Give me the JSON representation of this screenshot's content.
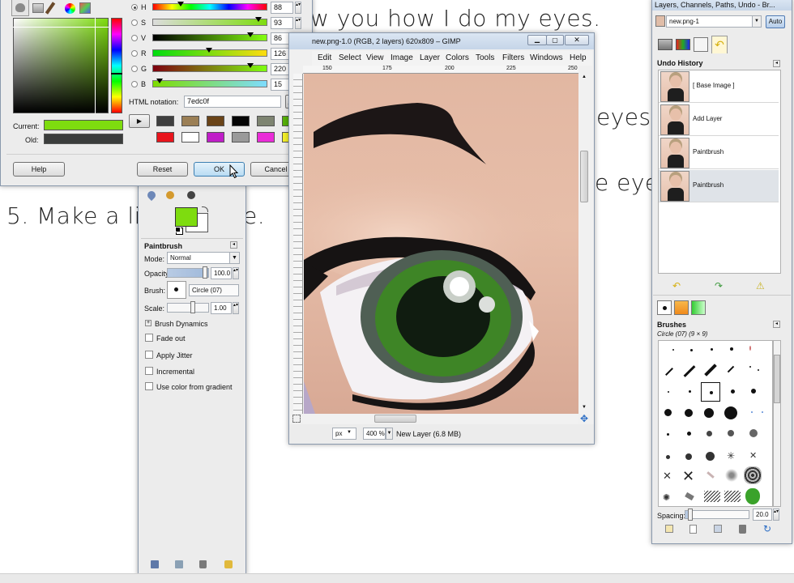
{
  "background_text": {
    "line1": "w you how I do my eyes.",
    "line_right1": "eyes.",
    "line_right2": "e eye.",
    "line_bottom": "5. Make a lig",
    "line_bottom_end": "e."
  },
  "color_dialog": {
    "channels": [
      {
        "label": "H",
        "value": "88"
      },
      {
        "label": "S",
        "value": "93"
      },
      {
        "label": "V",
        "value": "86"
      },
      {
        "label": "R",
        "value": "126"
      },
      {
        "label": "G",
        "value": "220"
      },
      {
        "label": "B",
        "value": "15"
      }
    ],
    "slider_levels": [
      0.24,
      0.93,
      0.86,
      0.49,
      0.86,
      0.06
    ],
    "html_notation_label": "HTML notation:",
    "html_notation_value": "7edc0f",
    "current_label": "Current:",
    "old_label": "Old:",
    "current_color": "#7edc0f",
    "old_color": "#3b3d3c",
    "history_colors": [
      "#3f3f3f",
      "#9b7f55",
      "#6a4418",
      "#050505",
      "#7e8471",
      "#56b008",
      "#e8141c",
      "#ffffff",
      "#c01ec8",
      "#9a9a9a",
      "#ea2cd8",
      "#f4ef2a"
    ],
    "buttons": {
      "help": "Help",
      "reset": "Reset",
      "ok": "OK",
      "cancel": "Cancel"
    }
  },
  "image_window": {
    "title": "new.png-1.0 (RGB, 2 layers) 620x809 – GIMP",
    "menu": [
      "Edit",
      "Select",
      "View",
      "Image",
      "Layer",
      "Colors",
      "Tools",
      "Filters",
      "Windows",
      "Help"
    ],
    "ruler": [
      "150",
      "175",
      "200",
      "225",
      "250"
    ],
    "unit": "px",
    "zoom": "400 %",
    "status": "New Layer (6.8 MB)"
  },
  "toolbox": {
    "tool_title": "Paintbrush",
    "mode_label": "Mode:",
    "mode_value": "Normal",
    "opacity_label": "Opacity:",
    "opacity_value": "100.0",
    "brush_label": "Brush:",
    "brush_value": "Circle (07)",
    "scale_label": "Scale:",
    "scale_value": "1.00",
    "brush_dynamics": "Brush Dynamics",
    "options": [
      "Fade out",
      "Apply Jitter",
      "Incremental",
      "Use color from gradient"
    ],
    "fg_color": "#7edc0f"
  },
  "layers_dock": {
    "title": "Layers, Channels, Paths, Undo - Br...",
    "image_select": "new.png-1",
    "auto_button": "Auto",
    "undo_title": "Undo History",
    "undo_items": [
      "[ Base Image ]",
      "Add Layer",
      "Paintbrush",
      "Paintbrush"
    ],
    "brushes_title": "Brushes",
    "brush_info": "Circle (07) (9 × 9)",
    "spacing_label": "Spacing:",
    "spacing_value": "20.0"
  }
}
